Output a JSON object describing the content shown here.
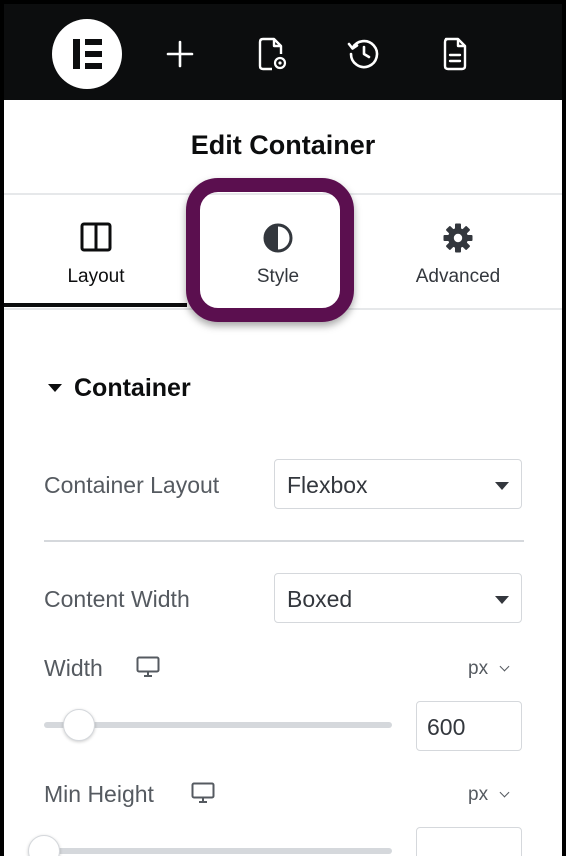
{
  "topbar": {
    "icons": [
      "elementor-logo-icon",
      "add-icon",
      "page-settings-icon",
      "history-icon",
      "document-icon"
    ]
  },
  "panel": {
    "title": "Edit Container",
    "tabs": [
      {
        "label": "Layout",
        "icon": "columns-icon",
        "active": true
      },
      {
        "label": "Style",
        "icon": "contrast-icon",
        "active": false,
        "highlighted": true
      },
      {
        "label": "Advanced",
        "icon": "gear-icon",
        "active": false
      }
    ],
    "highlight_color": "#5b0f4f",
    "section": {
      "title": "Container"
    },
    "fields": {
      "container_layout": {
        "label": "Container Layout",
        "value": "Flexbox"
      },
      "content_width": {
        "label": "Content Width",
        "value": "Boxed"
      },
      "width": {
        "label": "Width",
        "unit": "px",
        "value": "600",
        "device": "desktop-icon",
        "slider_level": 0.1
      },
      "min_height": {
        "label": "Min Height",
        "unit": "px",
        "device": "desktop-icon"
      }
    }
  }
}
